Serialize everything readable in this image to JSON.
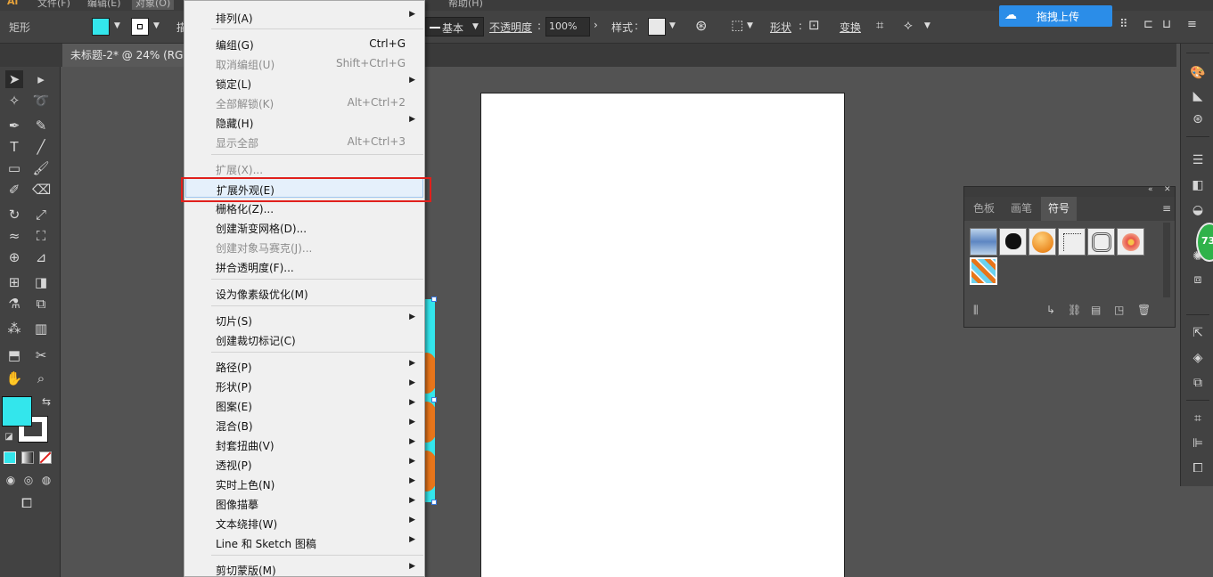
{
  "app": {
    "logo": "Ai",
    "top_menu": [
      "文件(F)",
      "编辑(E)",
      "对象(O)"
    ],
    "top_menu_right": "帮助(H)"
  },
  "control_bar": {
    "tool_name": "矩形",
    "fill_color": "#33e6ec",
    "stroke_partial": "描",
    "stroke_style": "基本",
    "opacity_label": "不透明度",
    "opacity_value": "100%",
    "style_label": "样式",
    "shape_label": "形状",
    "transform_label": "变换"
  },
  "document_tab": {
    "title": "未标题-2* @ 24% (RG"
  },
  "upload_button": {
    "label": "拖拽上传"
  },
  "context_menu": {
    "items": [
      {
        "label": "排列(A)",
        "submenu": true
      },
      {
        "label": "编组(G)",
        "shortcut": "Ctrl+G"
      },
      {
        "label": "取消编组(U)",
        "shortcut": "Shift+Ctrl+G",
        "disabled": true
      },
      {
        "label": "锁定(L)",
        "submenu": true
      },
      {
        "label": "全部解锁(K)",
        "shortcut": "Alt+Ctrl+2",
        "disabled": true
      },
      {
        "label": "隐藏(H)",
        "submenu": true
      },
      {
        "label": "显示全部",
        "shortcut": "Alt+Ctrl+3",
        "disabled": true
      },
      {
        "label": "扩展(X)...",
        "disabled": true
      },
      {
        "label": "扩展外观(E)",
        "highlighted": true
      },
      {
        "label": "栅格化(Z)..."
      },
      {
        "label": "创建渐变网格(D)..."
      },
      {
        "label": "创建对象马赛克(J)...",
        "disabled": true
      },
      {
        "label": "拼合透明度(F)..."
      },
      {
        "label": "设为像素级优化(M)"
      },
      {
        "label": "切片(S)",
        "submenu": true
      },
      {
        "label": "创建裁切标记(C)"
      },
      {
        "label": "路径(P)",
        "submenu": true
      },
      {
        "label": "形状(P)",
        "submenu": true
      },
      {
        "label": "图案(E)",
        "submenu": true
      },
      {
        "label": "混合(B)",
        "submenu": true
      },
      {
        "label": "封套扭曲(V)",
        "submenu": true
      },
      {
        "label": "透视(P)",
        "submenu": true
      },
      {
        "label": "实时上色(N)",
        "submenu": true
      },
      {
        "label": "图像描摹",
        "submenu": true
      },
      {
        "label": "文本绕排(W)",
        "submenu": true
      },
      {
        "label": "Line 和 Sketch 图稿",
        "submenu": true
      },
      {
        "label": "剪切蒙版(M)",
        "submenu": true
      }
    ]
  },
  "symbols_panel": {
    "tabs": [
      "色板",
      "画笔",
      "符号"
    ],
    "active_tab": "符号"
  },
  "badge": {
    "value": "73"
  },
  "colors": {
    "fill": "#33e6ec",
    "accent_orange": "#e8751a",
    "highlight_border": "#e0201c",
    "upload_blue": "#2b8de8"
  }
}
